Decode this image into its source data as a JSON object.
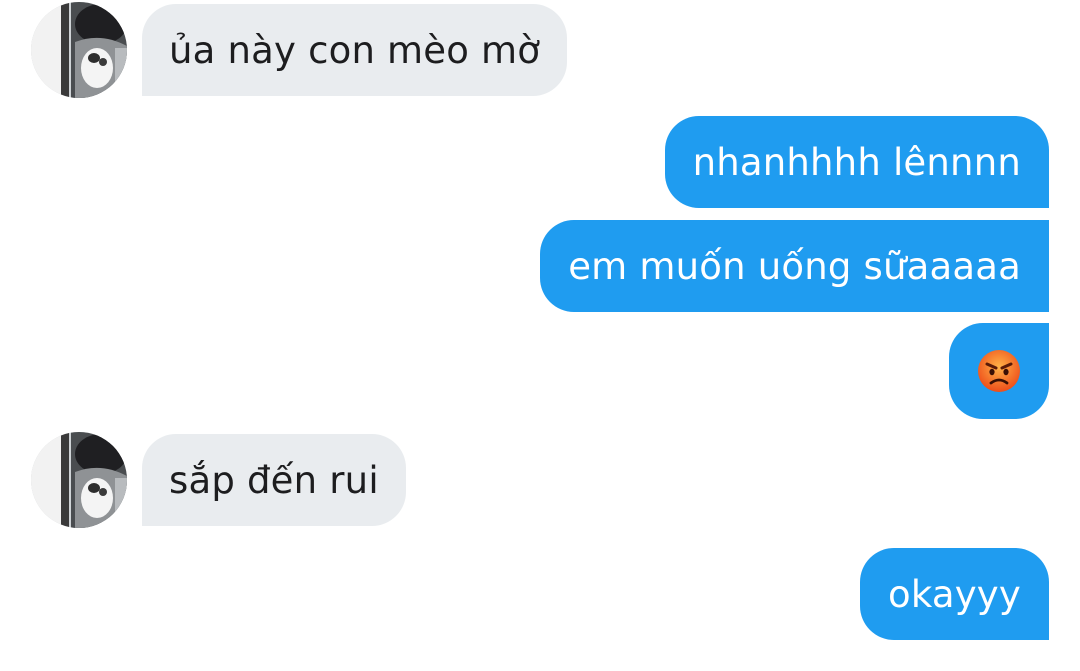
{
  "conversation": {
    "messages": [
      {
        "direction": "incoming",
        "text": "ủa này con mèo mờ"
      },
      {
        "direction": "outgoing",
        "text": "nhanhhhh lênnnn"
      },
      {
        "direction": "outgoing",
        "text": "em muốn uống sữaaaaa"
      },
      {
        "direction": "outgoing",
        "type": "emoji",
        "emoji": "angry-face"
      },
      {
        "direction": "incoming",
        "text": "sắp đến rui"
      },
      {
        "direction": "outgoing",
        "text": "okayyy"
      }
    ]
  },
  "colors": {
    "incoming_bubble": "#e9ecef",
    "outgoing_bubble": "#1f9cf0",
    "emoji_face": "#f06a2b"
  }
}
